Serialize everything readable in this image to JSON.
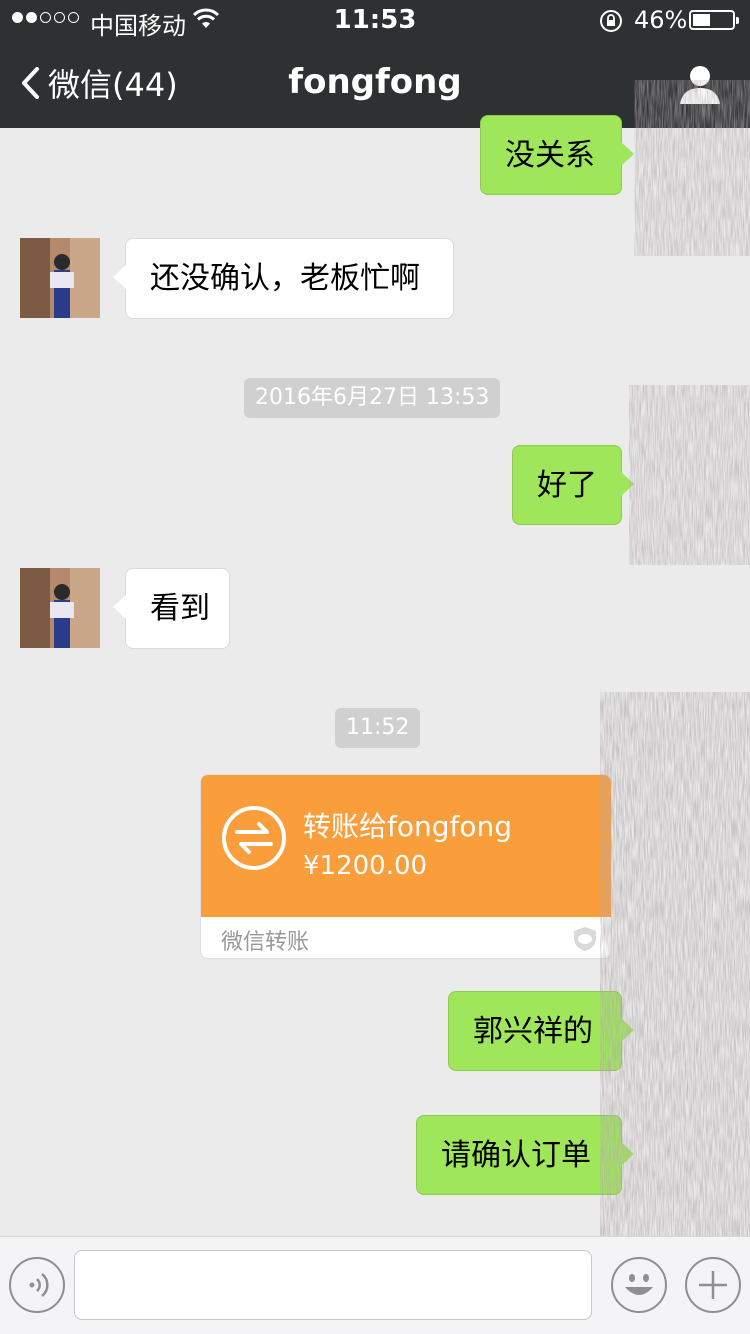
{
  "status_bar": {
    "carrier": "中国移动",
    "time": "11:53",
    "battery_percent": "46%",
    "battery_level": 0.46,
    "signal_strength": 2
  },
  "nav": {
    "back_label": "微信(44)",
    "title": "fongfong"
  },
  "messages": [
    {
      "side": "right",
      "text": "没关系"
    },
    {
      "side": "left",
      "text": "还没确认，老板忙啊"
    },
    {
      "type": "timestamp",
      "text": "2016年6月27日 13:53"
    },
    {
      "side": "right",
      "text": "好了"
    },
    {
      "side": "left",
      "text": "看到"
    },
    {
      "type": "timestamp",
      "text": "11:52"
    },
    {
      "type": "transfer",
      "side": "right",
      "label": "转账给fongfong",
      "amount": "¥1200.00",
      "caption": "微信转账"
    },
    {
      "side": "right",
      "text": "郭兴祥的"
    },
    {
      "side": "right",
      "text": "请确认订单"
    }
  ],
  "input_bar": {
    "placeholder": ""
  },
  "colors": {
    "nav_bg": "#2e3132",
    "chat_bg": "#ebebeb",
    "bubble_right": "#9fe65a",
    "bubble_left": "#ffffff",
    "transfer": "#fa9d3b"
  }
}
